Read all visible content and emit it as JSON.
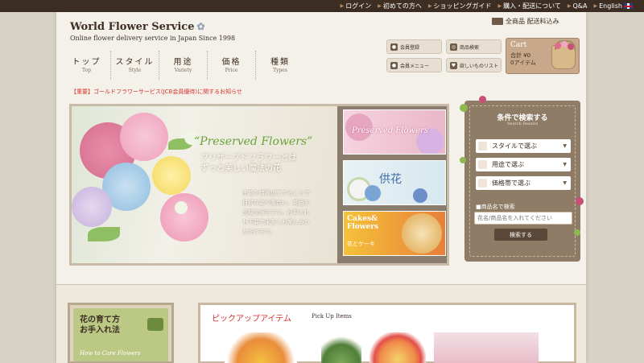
{
  "topbar": {
    "links": [
      {
        "label": "ログイン"
      },
      {
        "label": "初めての方へ"
      },
      {
        "label": "ショッピングガイド"
      },
      {
        "label": "購入・配送について"
      },
      {
        "label": "Q&A"
      },
      {
        "label": "English"
      }
    ]
  },
  "header": {
    "logo_title": "World Flower Service",
    "logo_tagline": "Online flower delivery service in Japan Since 1998",
    "shipping_label": "全商品 配送料込み",
    "nav": [
      {
        "jp": "トップ",
        "en": "Top"
      },
      {
        "jp": "スタイル",
        "en": "Style"
      },
      {
        "jp": "用途",
        "en": "Variety"
      },
      {
        "jp": "価格",
        "en": "Price"
      },
      {
        "jp": "種類",
        "en": "Types"
      }
    ],
    "member_buttons": [
      {
        "label": "会員登録",
        "icon": "person-icon"
      },
      {
        "label": "商品検索",
        "icon": "search-icon"
      },
      {
        "label": "会員メニュー",
        "icon": "person-icon"
      },
      {
        "label": "欲しいものリスト",
        "icon": "heart-icon"
      }
    ],
    "cart": {
      "title": "Cart",
      "total": "合計 ¥0",
      "items": "0アイテム"
    }
  },
  "notice": "【重要】ゴールドフラワーサービス(JCB会員優待)に関するお知らせ",
  "hero": {
    "title": "“Preserved Flowers”",
    "lead_lines": [
      "プリザーブドフラワーとは",
      "ずっと美しい魔法の花"
    ],
    "desc_lines": [
      "生花を特殊加工することで",
      "自然な姿や風合い、花色を",
      "長期間保ちます。お手入れ",
      "も不要で末永くお楽しみい",
      "ただけます。"
    ]
  },
  "side_banners": [
    {
      "label": "Preserved Flowers"
    },
    {
      "label": "供花"
    },
    {
      "label_lines": [
        "Cakes&",
        "Flowers"
      ],
      "sub": "花とケーキ"
    }
  ],
  "search": {
    "title": "条件で検索する",
    "subtitle": "Search Results",
    "selects": [
      {
        "label": "スタイルで選ぶ"
      },
      {
        "label": "用途で選ぶ"
      },
      {
        "label": "価格帯で選ぶ"
      }
    ],
    "name_label": "■商品名で検索",
    "input_placeholder": "花名/商品名を入れてください",
    "button_label": "検索する"
  },
  "lower": {
    "care_title_lines": [
      "花の育て方",
      "お手入れ法"
    ],
    "care_en": "How to Care Flowers",
    "pickup_title": "ピックアップアイテム",
    "pickup_en": "Pick Up Items"
  },
  "colors": {
    "topbar": "#3d2e24",
    "accent_red": "#d6322b",
    "accent_green": "#6aa23c",
    "search_panel": "#8f7c67"
  }
}
